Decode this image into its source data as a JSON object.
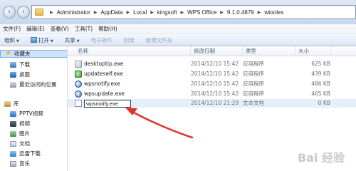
{
  "address_bar": {
    "path": [
      "Administrator",
      "AppData",
      "Local",
      "kingsoft",
      "WPS Office",
      "9.1.0.4879",
      "wtoolex"
    ]
  },
  "menu_bar": {
    "items": [
      "文件(F)",
      "编辑(E)",
      "查看(V)",
      "工具(T)",
      "帮助(H)"
    ]
  },
  "command_bar": {
    "organize": "组织",
    "open": "打开",
    "share": "共享",
    "email": "电子邮件",
    "burn": "刻录",
    "new_folder": "新建文件夹"
  },
  "nav_pane": {
    "favorites": "收藏夹",
    "favorites_items": [
      "下载",
      "桌面",
      "最近访问的位置"
    ],
    "libraries": "库",
    "library_items": [
      "PPTV视频",
      "视频",
      "图片",
      "文档",
      "迅雷下载",
      "音乐"
    ]
  },
  "file_list": {
    "columns": {
      "name": "名称",
      "date": "修改日期",
      "type": "类型",
      "size": "大小"
    },
    "rows": [
      {
        "name": "desktoptip.exe",
        "date": "2014/12/10 15:42",
        "type": "应用程序",
        "size": "625 KB",
        "icon": "exe-icon"
      },
      {
        "name": "updateself.exe",
        "date": "2014/12/10 15:42",
        "type": "应用程序",
        "size": "439 KB",
        "icon": "updater-icon"
      },
      {
        "name": "wpsnotify.exe",
        "date": "2014/12/10 15:42",
        "type": "应用程序",
        "size": "486 KB",
        "icon": "wps-icon"
      },
      {
        "name": "wpsupdate.exe",
        "date": "2014/12/10 15:42",
        "type": "应用程序",
        "size": "465 KB",
        "icon": "wps-icon"
      },
      {
        "name": "wpsnotify.exe",
        "date": "2014/12/10 21:29",
        "type": "文本文档",
        "size": "0 KB",
        "icon": "text-file-icon",
        "renaming": true
      }
    ]
  },
  "annotation": {
    "arrow_color": "#e0322a"
  },
  "watermark": {
    "text": "Bai 经验"
  }
}
